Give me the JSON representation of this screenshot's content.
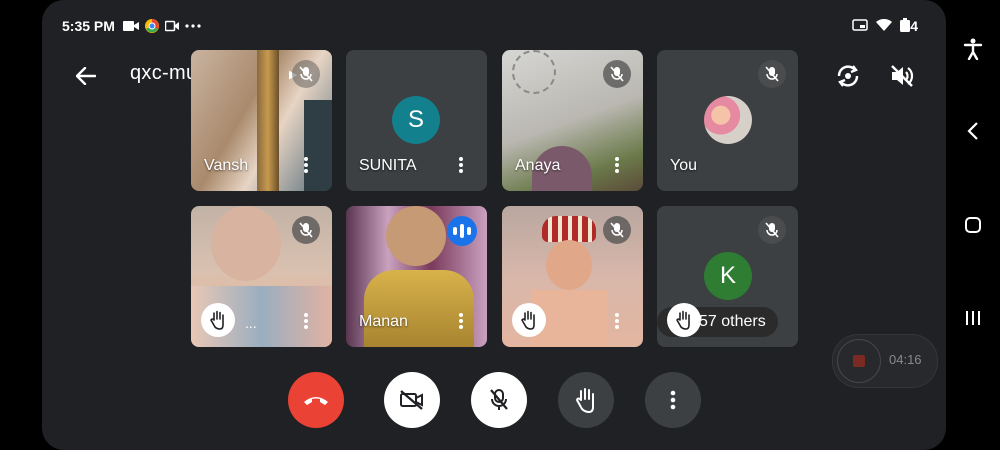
{
  "status": {
    "time": "5:35 PM",
    "battery": "4"
  },
  "meeting": {
    "code": "qxc-muhh-gox"
  },
  "participants": [
    {
      "name": "Vansh"
    },
    {
      "name": "SUNITA",
      "initial": "S"
    },
    {
      "name": "Anaya"
    },
    {
      "name": "You"
    },
    {
      "name": "..."
    },
    {
      "name": "Manan"
    },
    {
      "name": ""
    },
    {
      "initial": "K",
      "others": "57 others"
    }
  ],
  "recording": {
    "time": "04:16"
  },
  "colors": {
    "end_call": "#ea4335",
    "speaking": "#1a73e8",
    "avatar_s": "#12808d",
    "avatar_k": "#2e7d32"
  }
}
